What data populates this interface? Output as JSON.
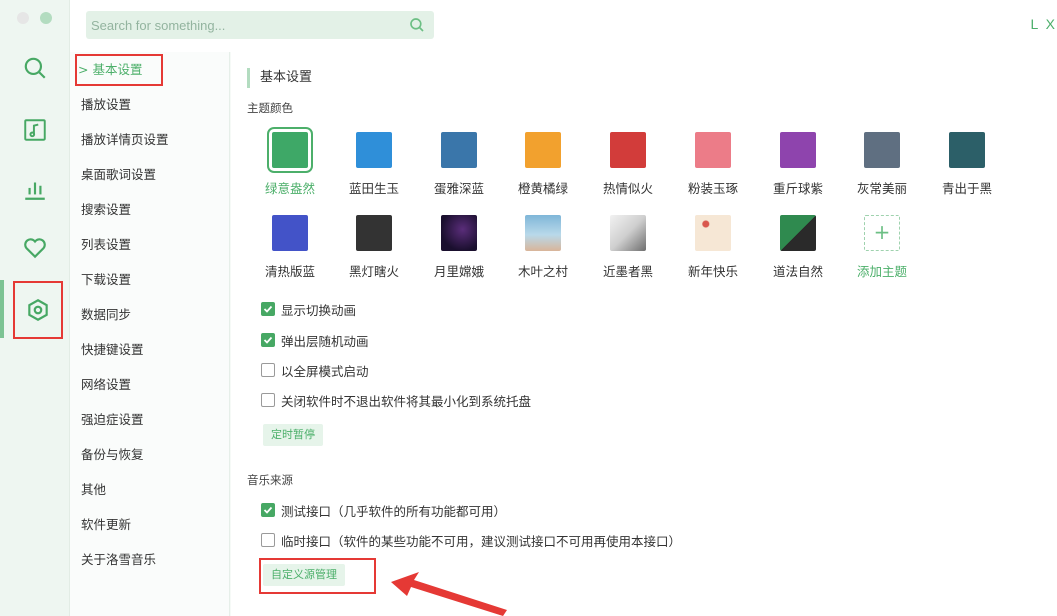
{
  "search": {
    "placeholder": "Search for something..."
  },
  "window_controls": {
    "right_text": "L X"
  },
  "left_nav": [
    {
      "icon": "search-icon"
    },
    {
      "icon": "music-note-icon"
    },
    {
      "icon": "bar-chart-icon"
    },
    {
      "icon": "heart-icon"
    },
    {
      "icon": "settings-icon",
      "active": true
    }
  ],
  "sub_nav": {
    "active_prefix": ">",
    "items": [
      "基本设置",
      "播放设置",
      "播放详情页设置",
      "桌面歌词设置",
      "搜索设置",
      "列表设置",
      "下载设置",
      "数据同步",
      "快捷键设置",
      "网络设置",
      "强迫症设置",
      "备份与恢复",
      "其他",
      "软件更新",
      "关于洛雪音乐"
    ]
  },
  "section": {
    "title": "基本设置"
  },
  "themes": {
    "label": "主题颜色",
    "items": [
      {
        "name": "绿意盎然",
        "color": "#3ea867",
        "selected": true
      },
      {
        "name": "蓝田生玉",
        "color": "#2f8fd9"
      },
      {
        "name": "蛋雅深蓝",
        "color": "#3a76aa"
      },
      {
        "name": "橙黄橘绿",
        "color": "#f2a12e"
      },
      {
        "name": "热情似火",
        "color": "#d23c3a"
      },
      {
        "name": "粉装玉琢",
        "color": "#ec7c88"
      },
      {
        "name": "重斤球紫",
        "color": "#8e44ad"
      },
      {
        "name": "灰常美丽",
        "color": "#5f6f81"
      },
      {
        "name": "青出于黑",
        "color": "#2c5f68"
      },
      {
        "name": "清热版蓝",
        "color": "#4353c8"
      },
      {
        "name": "黑灯瞎火",
        "color": "#333333"
      },
      {
        "name": "月里嫦娥",
        "color": "#1a0f2e"
      },
      {
        "name": "木叶之村",
        "color": "#7fb6d8"
      },
      {
        "name": "近墨者黑",
        "color": "#cfcfcf"
      },
      {
        "name": "新年快乐",
        "color": "#f6e7d5"
      },
      {
        "name": "道法自然",
        "color": "#2f8a4f"
      },
      {
        "name": "添加主题",
        "add": true,
        "symbol": "+"
      }
    ]
  },
  "options": [
    {
      "label": "显示切换动画",
      "checked": true
    },
    {
      "label": "弹出层随机动画",
      "checked": true
    },
    {
      "label": "以全屏模式启动",
      "checked": false
    },
    {
      "label": "关闭软件时不退出软件将其最小化到系统托盘",
      "checked": false
    }
  ],
  "timer_button": "定时暂停",
  "music_source": {
    "label": "音乐来源",
    "options": [
      {
        "label": "测试接口（几乎软件的所有功能都可用）",
        "checked": true
      },
      {
        "label": "临时接口（软件的某些功能不可用，建议测试接口不可用再使用本接口）",
        "checked": false
      }
    ],
    "custom_button": "自定义源管理"
  },
  "colors": {
    "accent": "#4caf6a",
    "highlight": "#e53935"
  }
}
